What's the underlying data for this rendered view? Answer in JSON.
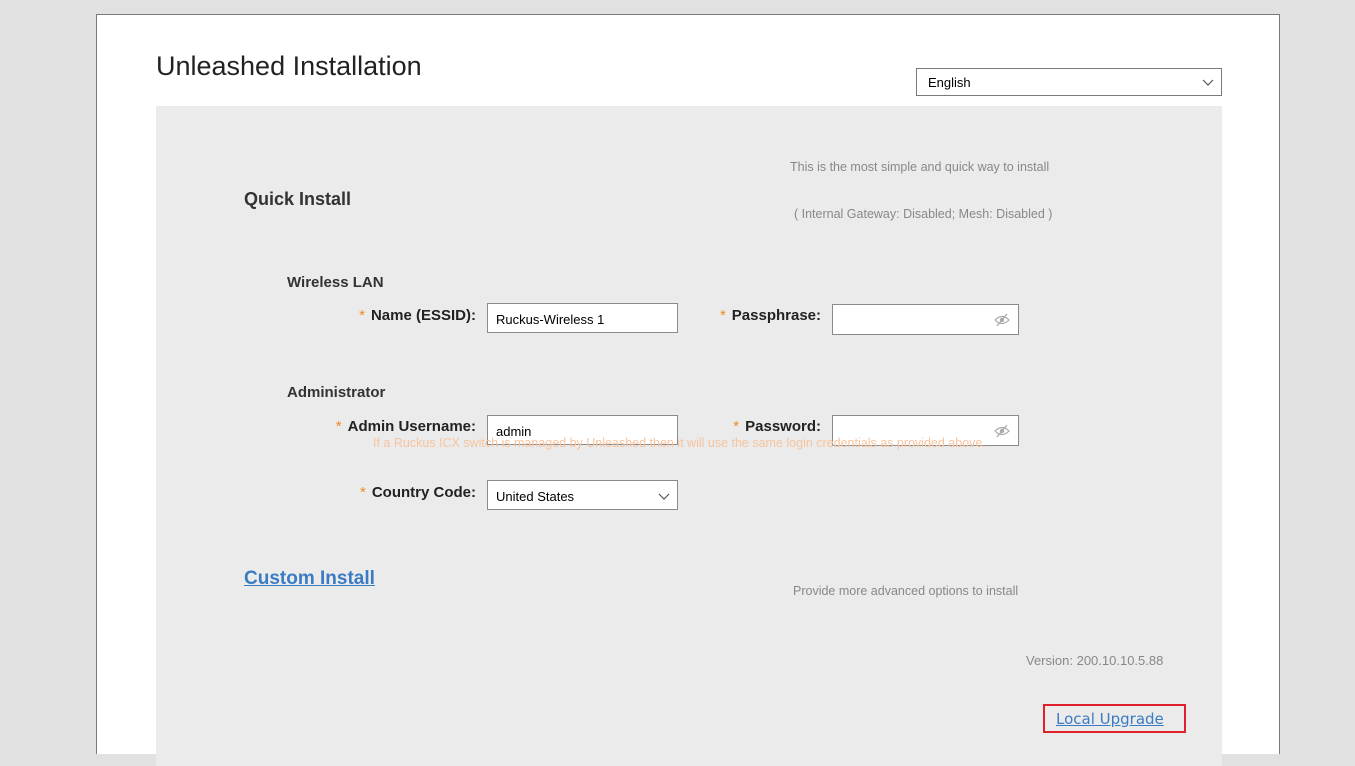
{
  "page": {
    "title": "Unleashed Installation",
    "language_select": {
      "value": "English"
    }
  },
  "quick_install": {
    "title": "Quick Install",
    "desc_line1": "This is the most simple and quick way to install",
    "desc_line2": "( Internal Gateway: Disabled; Mesh: Disabled )"
  },
  "wireless_lan": {
    "section": "Wireless LAN",
    "name_label": "Name (ESSID):",
    "name_value": "Ruckus-Wireless 1",
    "passphrase_label": "Passphrase:",
    "passphrase_value": ""
  },
  "administrator": {
    "section": "Administrator",
    "username_label": "Admin Username:",
    "username_value": "admin",
    "password_label": "Password:",
    "password_value": "",
    "note": "If a Ruckus ICX switch is managed by Unleashed then it will use the same login credentials as provided above.",
    "country_label": "Country Code:",
    "country_value": "United States"
  },
  "required_marker": "*",
  "custom_install": {
    "label": "Custom Install",
    "desc": "Provide more advanced options to install"
  },
  "footer": {
    "version": "Version: 200.10.10.5.88",
    "local_upgrade": "Local Upgrade"
  },
  "colors": {
    "accent_link": "#3a7cc3",
    "required_star": "#f08a24",
    "note_text": "#f7c49e",
    "highlight_box": "#e0202a",
    "panel_bg": "#ebebeb"
  },
  "icons": {
    "select_arrow": "chevron-down-icon",
    "password_toggle": "eye-slash-icon"
  }
}
